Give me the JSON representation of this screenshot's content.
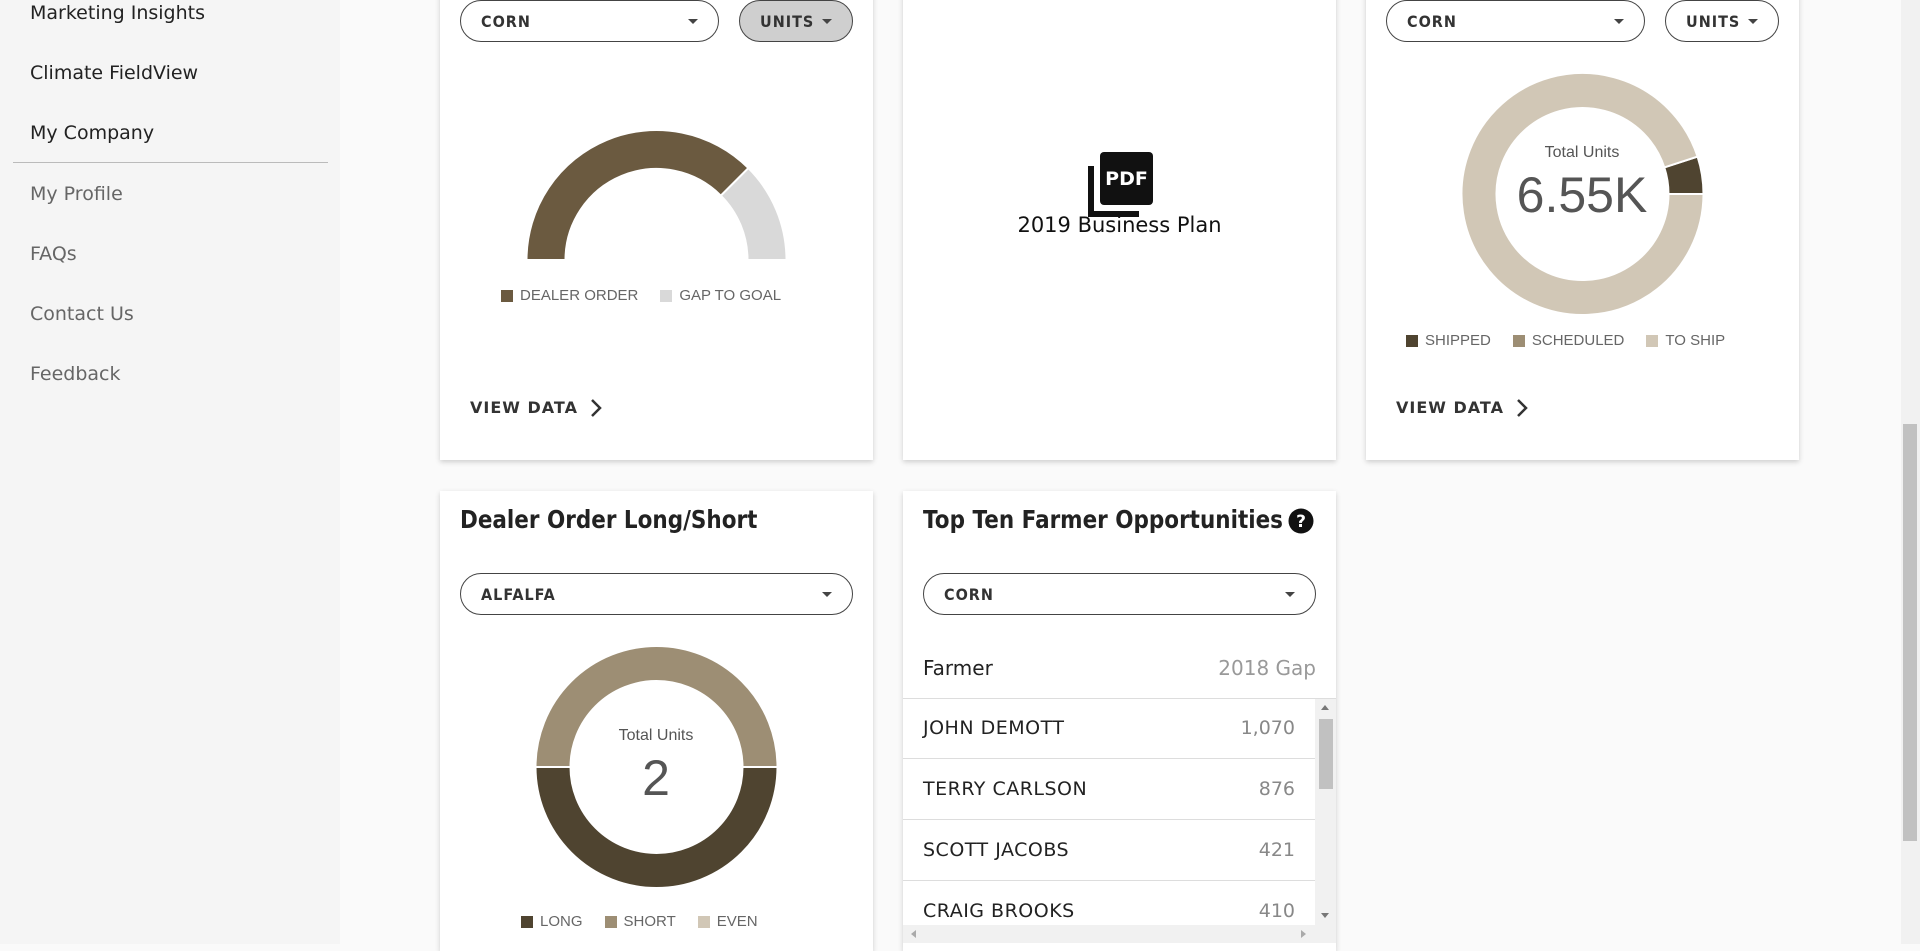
{
  "sidebar": {
    "items": [
      {
        "label": "Marketing Insights"
      },
      {
        "label": "Climate FieldView"
      },
      {
        "label": "My Company"
      },
      {
        "label": "My Profile"
      },
      {
        "label": "FAQs"
      },
      {
        "label": "Contact Us"
      },
      {
        "label": "Feedback"
      }
    ]
  },
  "card1": {
    "crop": "CORN",
    "measure": "UNITS",
    "legend": [
      "DEALER ORDER",
      "GAP TO GOAL"
    ],
    "view_data": "VIEW DATA"
  },
  "card2": {
    "pdf_icon_text": "PDF",
    "label": "2019 Business Plan"
  },
  "card3": {
    "crop": "CORN",
    "measure": "UNITS",
    "center_label": "Total Units",
    "center_value": "6.55K",
    "legend": [
      "SHIPPED",
      "SCHEDULED",
      "TO SHIP"
    ],
    "view_data": "VIEW DATA"
  },
  "card4": {
    "title": "Dealer Order Long/Short",
    "crop": "ALFALFA",
    "center_label": "Total Units",
    "center_value": "2",
    "legend": [
      "LONG",
      "SHORT",
      "EVEN"
    ]
  },
  "card5": {
    "title": "Top Ten Farmer Opportunities",
    "crop": "CORN",
    "col_farmer": "Farmer",
    "col_gap": "2018 Gap",
    "rows": [
      {
        "name": "JOHN DEMOTT",
        "value": "1,070"
      },
      {
        "name": "TERRY CARLSON",
        "value": "876"
      },
      {
        "name": "SCOTT JACOBS",
        "value": "421"
      },
      {
        "name": "CRAIG BROOKS",
        "value": "410"
      }
    ]
  },
  "colors": {
    "dark_brown": "#6b5a40",
    "darker_brown": "#4f4430",
    "taupe": "#9d8e74",
    "light_taupe": "#d1c7b6",
    "gray": "#d9d9d9"
  },
  "chart_data": [
    {
      "type": "pie",
      "variant": "gauge",
      "categories": [
        "DEALER ORDER",
        "GAP TO GOAL"
      ],
      "values": [
        75,
        25
      ]
    },
    {
      "type": "pie",
      "variant": "donut",
      "categories": [
        "SHIPPED",
        "SCHEDULED",
        "TO SHIP"
      ],
      "values": [
        5,
        0,
        95
      ]
    },
    {
      "type": "pie",
      "variant": "donut",
      "categories": [
        "LONG",
        "SHORT",
        "EVEN"
      ],
      "values": [
        1,
        1,
        0
      ]
    }
  ]
}
